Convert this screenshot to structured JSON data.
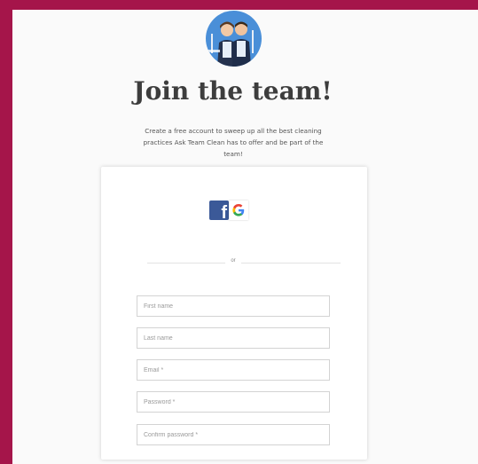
{
  "header": {
    "title": "Join the team!",
    "subtitle": "Create a free account to sweep up all the best cleaning practices Ask Team Clean has to offer and be part of the team!"
  },
  "social": {
    "facebook_icon": "facebook-icon",
    "google_icon": "google-icon",
    "facebook_color": "#3b5998"
  },
  "divider": {
    "label": "or"
  },
  "form": {
    "first_name_placeholder": "First name",
    "last_name_placeholder": "Last name",
    "email_placeholder": "Email *",
    "password_placeholder": "Password *",
    "confirm_password_placeholder": "Confirm password *"
  },
  "colors": {
    "border_frame": "#a5154a",
    "avatar_bg": "#4a8fd8",
    "title_text": "#3d3d3d"
  }
}
